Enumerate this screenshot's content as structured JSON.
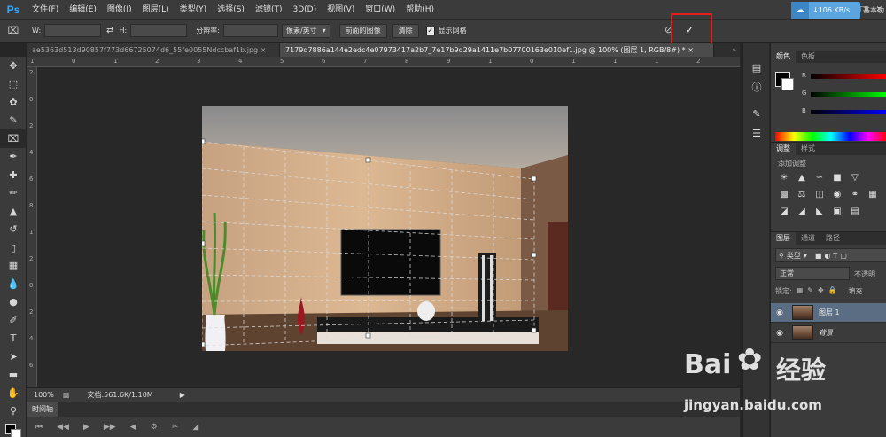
{
  "app": {
    "logo": "Ps"
  },
  "menu": [
    "文件(F)",
    "编辑(E)",
    "图像(I)",
    "图层(L)",
    "类型(Y)",
    "选择(S)",
    "滤镜(T)",
    "3D(D)",
    "视图(V)",
    "窗口(W)",
    "帮助(H)"
  ],
  "options": {
    "w_label": "W:",
    "w_value": "",
    "h_label": "H:",
    "h_value": "",
    "resolution_label": "分辨率:",
    "resolution_value": "",
    "unit_select": "像素/英寸",
    "front_image_btn": "前面的图像",
    "clear_btn": "清除",
    "show_grid_label": "显示网格",
    "show_grid_checked": true,
    "commit_icon": "checkmark-icon",
    "cancel_icon": "cancel-icon"
  },
  "network": {
    "speed": "106 KB/s"
  },
  "workspace": {
    "label": "基本功"
  },
  "tabs": [
    {
      "label": "ae5363d513d90857f773d66725074d6_55fe0055Ndccbaf1b.jpg",
      "active": false
    },
    {
      "label": "7179d7886a144e2edc4e07973417a2b7_7e17b9d29a1411e7b07700163e010ef1.jpg @ 100% (图层 1, RGB/8#) *",
      "active": true
    }
  ],
  "status": {
    "zoom": "100%",
    "doc_info": "文档:561.6K/1.10M"
  },
  "timeline": {
    "tab_label": "时间轴"
  },
  "color_panel": {
    "tabs": [
      "颜色",
      "色板"
    ],
    "sliders": [
      {
        "label": "R",
        "color": "#ff0000"
      },
      {
        "label": "G",
        "color": "#00ff00"
      },
      {
        "label": "B",
        "color": "#0000ff"
      }
    ]
  },
  "adjustments_panel": {
    "tabs": [
      "调整",
      "样式"
    ],
    "title": "添加调整"
  },
  "layers_panel": {
    "tabs": [
      "图层",
      "通道",
      "路径"
    ],
    "filter_label": "类型",
    "blend_mode": "正常",
    "opacity_label": "不透明",
    "lock_label": "锁定:",
    "fill_label": "填充",
    "layers": [
      {
        "name": "图层 1",
        "active": true,
        "italic": false
      },
      {
        "name": "背景",
        "active": false,
        "italic": true
      }
    ]
  },
  "ruler": {
    "top_ticks": [
      "1",
      "0",
      "1",
      "2",
      "3",
      "4",
      "5",
      "6",
      "7",
      "8",
      "9",
      "1",
      "0",
      "1",
      "1",
      "1",
      "2"
    ],
    "left_ticks": [
      "2",
      "0",
      "2",
      "4",
      "6",
      "8",
      "1",
      "2",
      "0",
      "2",
      "4",
      "6"
    ]
  },
  "watermark": {
    "brand": "Bai",
    "brand2": "经验",
    "url": "jingyan.baidu.com"
  }
}
